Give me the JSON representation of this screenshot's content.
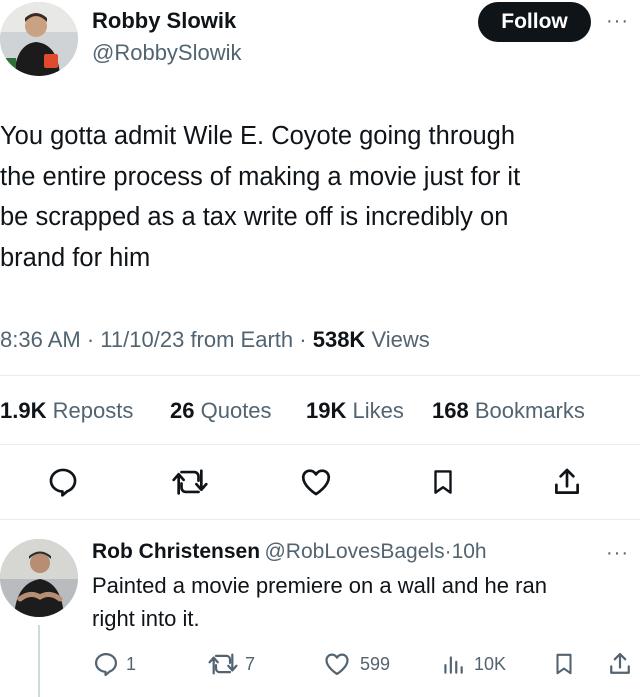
{
  "tweet": {
    "author_name": "Robby Slowik",
    "author_handle": "@RobbySlowik",
    "follow_label": "Follow",
    "more_label": "···",
    "text_lines": [
      "You gotta admit Wile E. Coyote going through",
      "the entire process of making a movie just for it",
      "be scrapped as a tax write off is incredibly on",
      "brand for him"
    ],
    "time": "8:36 AM",
    "sep": "·",
    "date": "11/10/23",
    "source": "from Earth",
    "views_count": "538K",
    "views_label": "Views",
    "stats": {
      "reposts_count": "1.9K",
      "reposts_label": "Reposts",
      "quotes_count": "26",
      "quotes_label": "Quotes",
      "likes_count": "19K",
      "likes_label": "Likes",
      "bookmarks_count": "168",
      "bookmarks_label": "Bookmarks"
    },
    "icons": [
      "reply-icon",
      "repost-icon",
      "like-icon",
      "bookmark-icon",
      "share-icon"
    ]
  },
  "reply": {
    "author_name": "Rob Christensen",
    "author_handle": "@RobLovesBagels",
    "sep": "·",
    "age": "10h",
    "more_label": "···",
    "text_lines": [
      "Painted a movie premiere on a wall and he ran",
      "right into it."
    ],
    "actions": {
      "replies": "1",
      "reposts": "7",
      "likes": "599",
      "views": "10K"
    }
  },
  "colors": {
    "text": "#0f1419",
    "secondary": "#536471",
    "divider": "#e6ecf0",
    "follow_bg": "#0f1419"
  }
}
